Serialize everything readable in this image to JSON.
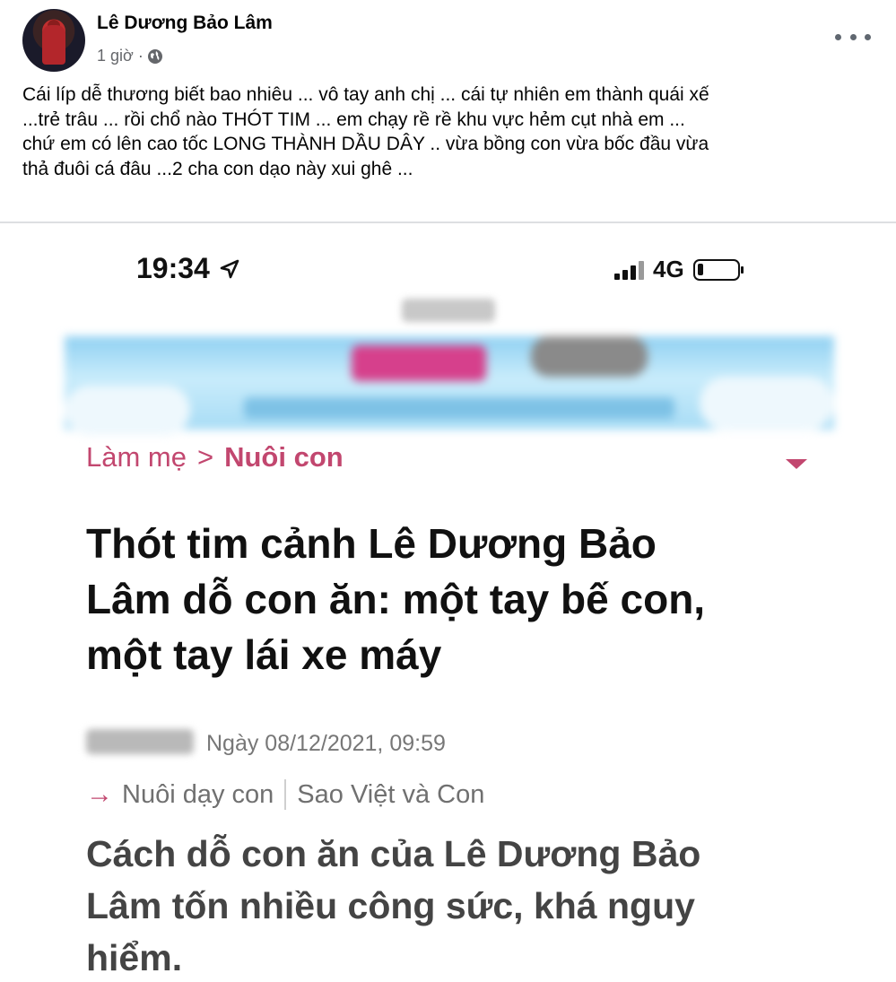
{
  "post": {
    "author": "Lê Dương Bảo Lâm",
    "time": "1 giờ ·",
    "audience_icon": "globe-icon",
    "more_icon": "more-horizontal-icon",
    "text_lines": [
      "Cái líp dễ thương biết bao nhiêu ... vô tay anh chị ... cái tự nhiên em thành quái xế",
      "...trẻ trâu ... rồi chổ nào THÓT TIM ... em chạy rề rề khu vực hẻm cụt nhà em ...",
      "chứ em có lên cao tốc LONG THÀNH DẦU DÂY .. vừa bồng con vừa bốc đầu vừa",
      "thả đuôi cá đâu ...2 cha con dạo này xui ghê ..."
    ]
  },
  "screenshot": {
    "status_bar": {
      "time": "19:34",
      "network": "4G",
      "battery_level": 0.15
    },
    "breadcrumb": {
      "parent": "Làm mẹ",
      "separator": ">",
      "current": "Nuôi con"
    },
    "headline_lines": [
      "Thót tim cảnh Lê Dương Bảo",
      "Lâm dỗ con ăn: một tay bế con,",
      "một tay lái xe máy"
    ],
    "date": "Ngày 08/12/2021, 09:59",
    "categories": {
      "arrow": "→",
      "first": "Nuôi dạy con",
      "second": "Sao Việt và Con"
    },
    "sapo_lines": [
      "Cách dỗ con ăn của Lê Dương Bảo",
      "Lâm tốn nhiều công sức, khá nguy",
      "hiểm."
    ]
  },
  "colors": {
    "accent_pink": "#c2476f",
    "fb_secondary_text": "#65676b"
  }
}
